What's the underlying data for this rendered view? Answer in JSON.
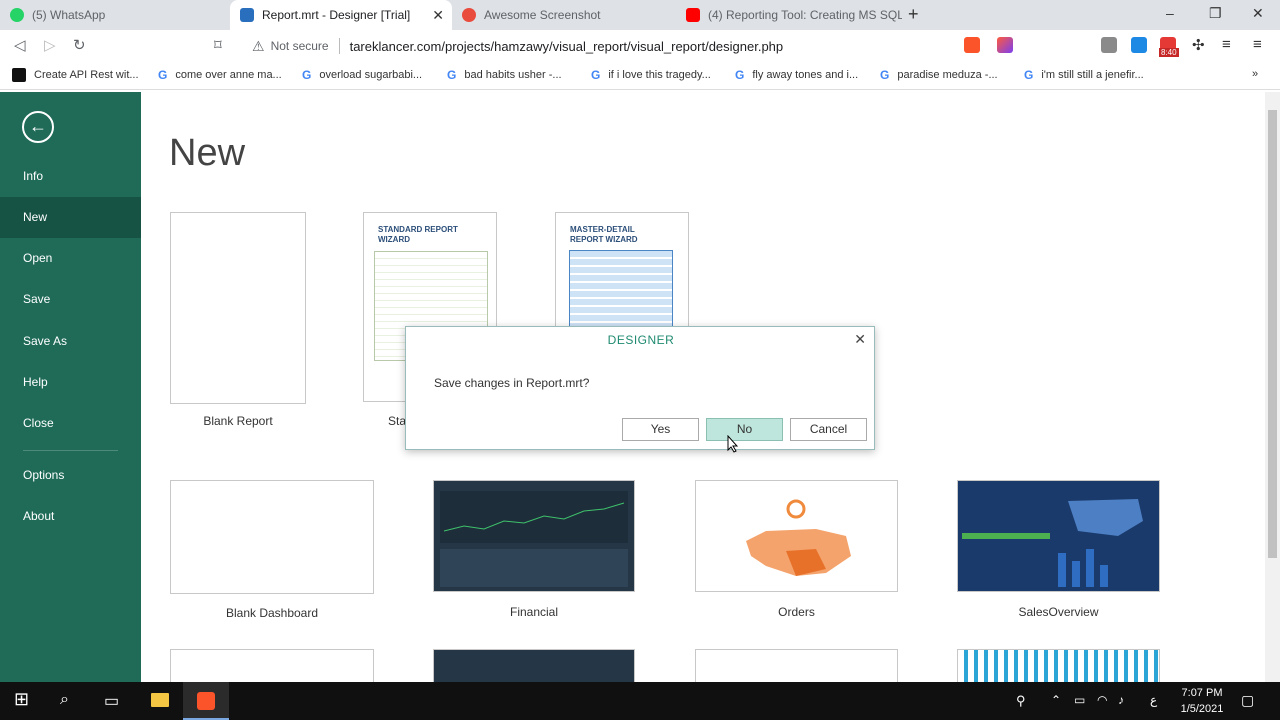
{
  "browser": {
    "tabs": [
      {
        "title": "(5) WhatsApp",
        "favicon_color": "#25d366"
      },
      {
        "title": "Report.mrt - Designer [Trial]",
        "favicon_color": "#2a6fbd",
        "active": true
      },
      {
        "title": "Awesome Screenshot",
        "favicon_color": "#e94b3c"
      },
      {
        "title": "(4) Reporting Tool: Creating MS SQL C",
        "favicon_color": "#ff0000"
      }
    ],
    "new_tab_glyph": "+",
    "window_controls": [
      "–",
      "❐",
      "✕"
    ],
    "address": {
      "security_label": "Not secure",
      "url": "tareklancer.com/projects/hamzawy/visual_report/visual_report/designer.php"
    },
    "bookmarks": [
      {
        "label": "Create API Rest wit...",
        "icon": "dev-icon"
      },
      {
        "label": "come over anne ma...",
        "icon": "google-icon"
      },
      {
        "label": "overload sugarbabi...",
        "icon": "google-icon"
      },
      {
        "label": "bad habits usher -...",
        "icon": "google-icon"
      },
      {
        "label": "if i love this tragedy...",
        "icon": "google-icon"
      },
      {
        "label": "fly away tones and i...",
        "icon": "google-icon"
      },
      {
        "label": "paradise meduza -...",
        "icon": "google-icon"
      },
      {
        "label": "i'm still still a jenefir...",
        "icon": "google-icon"
      }
    ],
    "extension_badge": "8:40"
  },
  "sidebar": {
    "back_glyph": "←",
    "items": [
      "Info",
      "New",
      "Open",
      "Save",
      "Save As",
      "Help",
      "Close",
      "Options",
      "About"
    ],
    "active": "New"
  },
  "main": {
    "heading": "New",
    "reports": [
      {
        "label": "Blank Report"
      },
      {
        "label": "Sta",
        "wizard_title": "STANDARD REPORT WIZARD"
      },
      {
        "label": "",
        "wizard_title": "MASTER-DETAIL REPORT WIZARD"
      }
    ],
    "dashboards": [
      {
        "label": "Blank Dashboard"
      },
      {
        "label": "Financial"
      },
      {
        "label": "Orders"
      },
      {
        "label": "SalesOverview"
      }
    ]
  },
  "dialog": {
    "title": "DESIGNER",
    "close_glyph": "✕",
    "message": "Save changes in Report.mrt?",
    "buttons": {
      "yes": "Yes",
      "no": "No",
      "cancel": "Cancel"
    }
  },
  "taskbar": {
    "time": "7:07 PM",
    "date": "1/5/2021",
    "lang": "ع"
  },
  "colors": {
    "sidebar": "#1f6b58",
    "sidebar_active": "#175344",
    "dialog_title": "#1f8a70"
  }
}
